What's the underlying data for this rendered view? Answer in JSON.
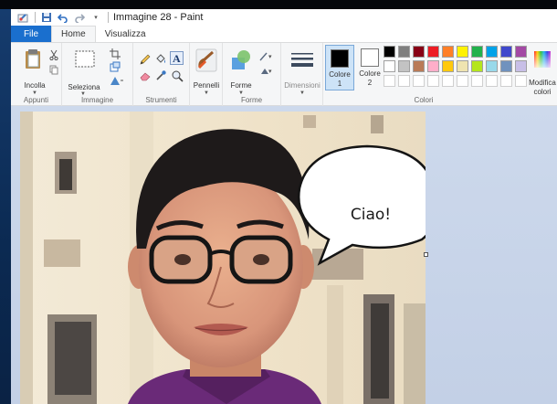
{
  "window": {
    "title": "Immagine 28 - Paint"
  },
  "tabs": [
    {
      "label": "File"
    },
    {
      "label": "Home"
    },
    {
      "label": "Visualizza"
    }
  ],
  "ribbon": {
    "appunti": {
      "paste_label": "Incolla",
      "group_label": "Appunti"
    },
    "immagine": {
      "select_label": "Seleziona",
      "group_label": "Immagine"
    },
    "strumenti": {
      "group_label": "Strumenti"
    },
    "pennelli": {
      "label": "Pennelli"
    },
    "forme": {
      "label": "Forme",
      "group_label": "Forme"
    },
    "dimensioni": {
      "label": "Dimensioni"
    },
    "colori": {
      "color1_label": "Colore",
      "color1_num": "1",
      "color2_label": "Colore",
      "color2_num": "2",
      "edit_label_1": "Modifica",
      "edit_label_2": "colori",
      "group_label": "Colori",
      "color1_value": "#000000",
      "color2_value": "#ffffff",
      "palette_row1": [
        "#000000",
        "#7f7f7f",
        "#880015",
        "#ed1c24",
        "#ff7f27",
        "#fff200",
        "#22b14c",
        "#00a2e8",
        "#3f48cc",
        "#a349a4"
      ],
      "palette_row2": [
        "#ffffff",
        "#c3c3c3",
        "#b97a57",
        "#ffaec9",
        "#ffc90e",
        "#efe4b0",
        "#b5e61d",
        "#99d9ea",
        "#7092be",
        "#c8bfe7"
      ]
    }
  },
  "canvas": {
    "speech_bubble_text": "Ciao!"
  }
}
